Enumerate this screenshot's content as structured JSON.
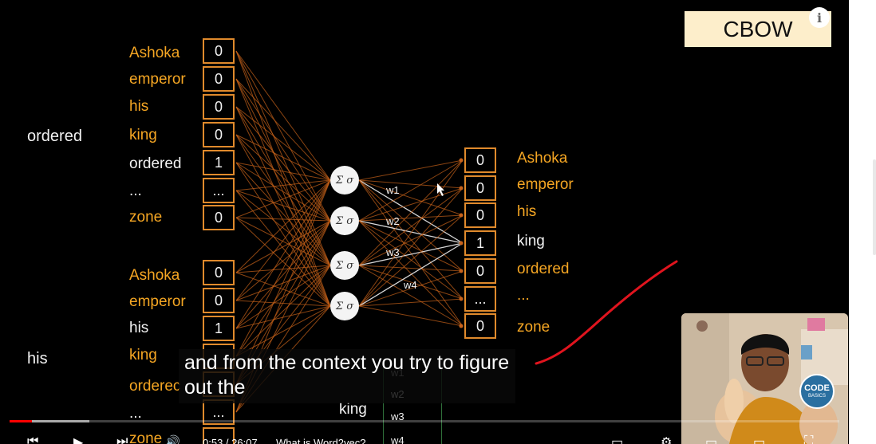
{
  "slide": {
    "badge": "CBOW",
    "context_labels": [
      "ordered",
      "his"
    ],
    "input_vector_1": {
      "words": [
        "Ashoka",
        "emperor",
        "his",
        "king",
        "ordered",
        "...",
        "zone"
      ],
      "values": [
        "0",
        "0",
        "0",
        "0",
        "1",
        "...",
        "0"
      ]
    },
    "input_vector_2": {
      "words": [
        "Ashoka",
        "emperor",
        "his",
        "king",
        "orderec",
        "...",
        "zone"
      ],
      "values": [
        "0",
        "0",
        "1",
        "",
        "",
        "...",
        ""
      ]
    },
    "neuron_symbol": "Σ σ",
    "weight_labels": [
      "w1",
      "w2",
      "w3",
      "w4"
    ],
    "output_vector": {
      "words": [
        "Ashoka",
        "emperor",
        "his",
        "king",
        "ordered",
        "...",
        "zone"
      ],
      "values": [
        "0",
        "0",
        "0",
        "1",
        "0",
        "...",
        "0"
      ]
    },
    "lower_target_word": "king",
    "lower_weight_labels": [
      "w1",
      "w2",
      "w3",
      "w4"
    ]
  },
  "caption": {
    "line1": "and from the context you try to figure",
    "line2": "out the"
  },
  "webcam": {
    "logo_line1": "CODE",
    "logo_line2": "BASICS"
  },
  "player": {
    "time_text": "0:53 / 26:07",
    "chapter_text": "What is Word2vec?",
    "info_icon": "i",
    "played_fraction": 0.027,
    "buffered_fraction": 0.096
  },
  "colors": {
    "accent_orange": "#f5a623",
    "cell_border": "#e08a2c",
    "badge_bg": "#fdeecb",
    "annotation_red": "#e0141e",
    "progress_red": "#ff0000"
  }
}
